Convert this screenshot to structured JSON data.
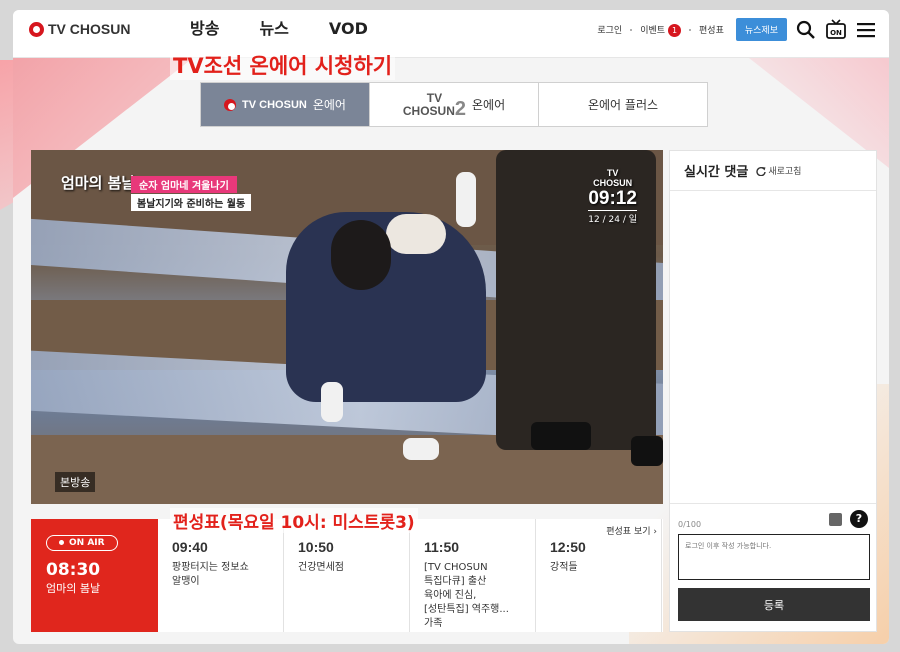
{
  "header": {
    "logo_text": "TV CHOSUN",
    "nav": [
      "방송",
      "뉴스",
      "VOD"
    ],
    "login": "로그인",
    "event": "이벤트",
    "event_badge": "1",
    "schedule": "편성표",
    "report_button": "뉴스제보"
  },
  "page_title": "TV조선 온에어 시청하기",
  "tabs": [
    {
      "brand": "TV CHOSUN",
      "label": "온에어"
    },
    {
      "brand_top": "TV",
      "brand_bottom": "CHOSUN",
      "brand_num": "2",
      "label": "온에어"
    },
    {
      "label": "온에어 플러스"
    }
  ],
  "player": {
    "program_logo": "엄마의 봄날",
    "caption_line1": "순자 엄마네 겨울나기",
    "caption_line2": "봄날지기와 준비하는 월동",
    "bug_brand_top": "TV",
    "bug_brand": "CHOSUN",
    "bug_time": "09:12",
    "bug_date": "12 / 24 / 일",
    "live_tag": "본방송"
  },
  "chat": {
    "title": "실시간 댓글",
    "refresh": "새로고침",
    "counter": "0/100",
    "input_placeholder": "로그인 이후 작성 가능합니다.",
    "submit": "등록",
    "help": "?"
  },
  "schedule_title": "편성표(목요일 10시: 미스트롯3)",
  "schedule": {
    "onair_label": "ON AIR",
    "onair_time": "08:30",
    "onair_program": "엄마의 봄날",
    "view_link": "편성표 보기",
    "slots": [
      {
        "time": "09:40",
        "program": "팡팡터지는 정보쇼\n알맹이"
      },
      {
        "time": "10:50",
        "program": "건강면세점"
      },
      {
        "time": "11:50",
        "program": "[TV CHOSUN\n특집다큐] 출산\n육아에 진심,\n[성탄특집] 역주행...\n가족"
      },
      {
        "time": "12:50",
        "program": "강적들"
      }
    ]
  },
  "colors": {
    "brand_red": "#e0261d",
    "tab_active": "#7b8597",
    "report_blue": "#3c8ed9"
  }
}
